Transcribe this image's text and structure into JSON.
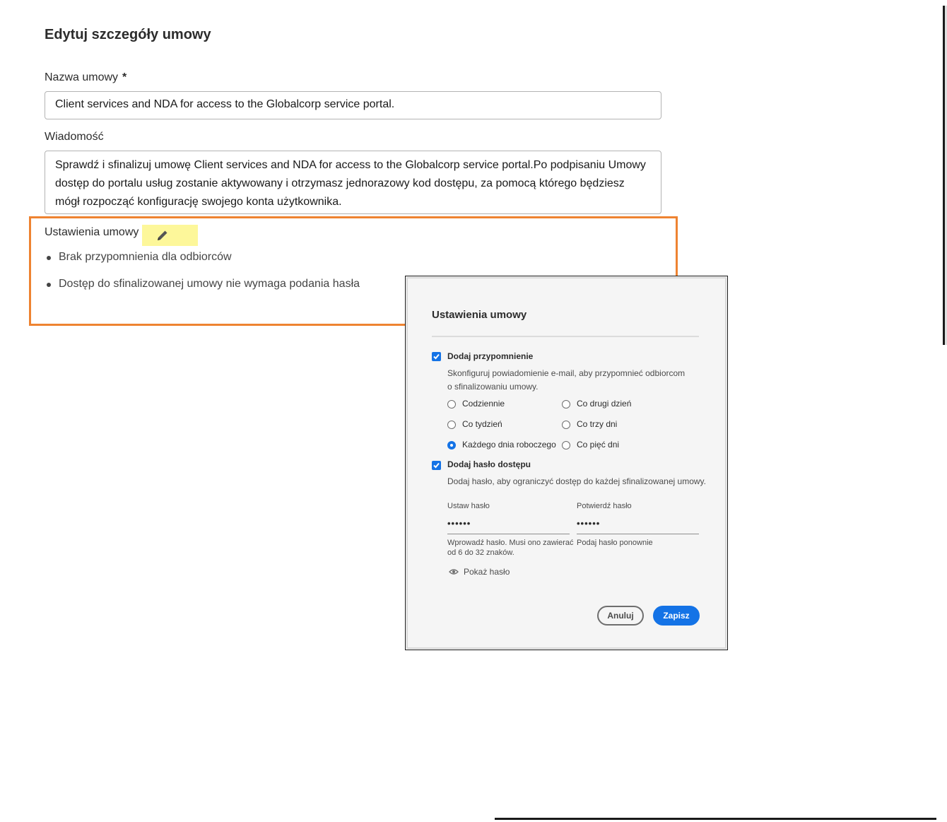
{
  "page": {
    "title": "Edytuj szczegóły umowy",
    "agreement_name_label": "Nazwa umowy",
    "required_mark": "*",
    "agreement_name_value": "Client services and NDA for access to the Globalcorp service portal.",
    "message_label": "Wiadomość",
    "message_value": "Sprawdź i sfinalizuj umowę Client services and NDA for access to the Globalcorp service portal.Po podpisaniu Umowy dostęp do portalu usług zostanie aktywowany i otrzymasz jednorazowy kod dostępu, za pomocą którego będziesz mógł rozpocząć konfigurację swojego konta użytkownika.",
    "settings_label": "Ustawienia umowy",
    "settings_items": [
      "Brak przypomnienia dla odbiorców",
      "Dostęp do sfinalizowanej umowy nie wymaga podania hasła"
    ],
    "highlight_color": "#ee8331",
    "edit_icon": "pencil-icon"
  },
  "modal": {
    "title": "Ustawienia umowy",
    "reminder": {
      "checked": true,
      "label": "Dodaj przypomnienie",
      "description_line1": "Skonfiguruj powiadomienie e-mail, aby przypomnieć odbiorcom",
      "description_line2": "o sfinalizowaniu umowy.",
      "options": [
        {
          "label": "Codziennie",
          "selected": false
        },
        {
          "label": "Co drugi dzień",
          "selected": false
        },
        {
          "label": "Co tydzień",
          "selected": false
        },
        {
          "label": "Co trzy dni",
          "selected": false
        },
        {
          "label": "Każdego dnia roboczego",
          "selected": true
        },
        {
          "label": "Co pięć dni",
          "selected": false
        }
      ]
    },
    "password": {
      "checked": true,
      "label": "Dodaj hasło dostępu",
      "description": "Dodaj hasło, aby ograniczyć dostęp do każdej sfinalizowanej umowy.",
      "set_label": "Ustaw hasło",
      "set_value": "••••••",
      "set_help_line1": "Wprowadź hasło. Musi ono zawierać",
      "set_help_line2": "od 6 do 32 znaków.",
      "confirm_label": "Potwierdź hasło",
      "confirm_value": "••••••",
      "confirm_help": "Podaj hasło ponownie",
      "show_label": "Pokaż hasło"
    },
    "cancel_label": "Anuluj",
    "save_label": "Zapisz",
    "accent_color": "#1473e6"
  }
}
